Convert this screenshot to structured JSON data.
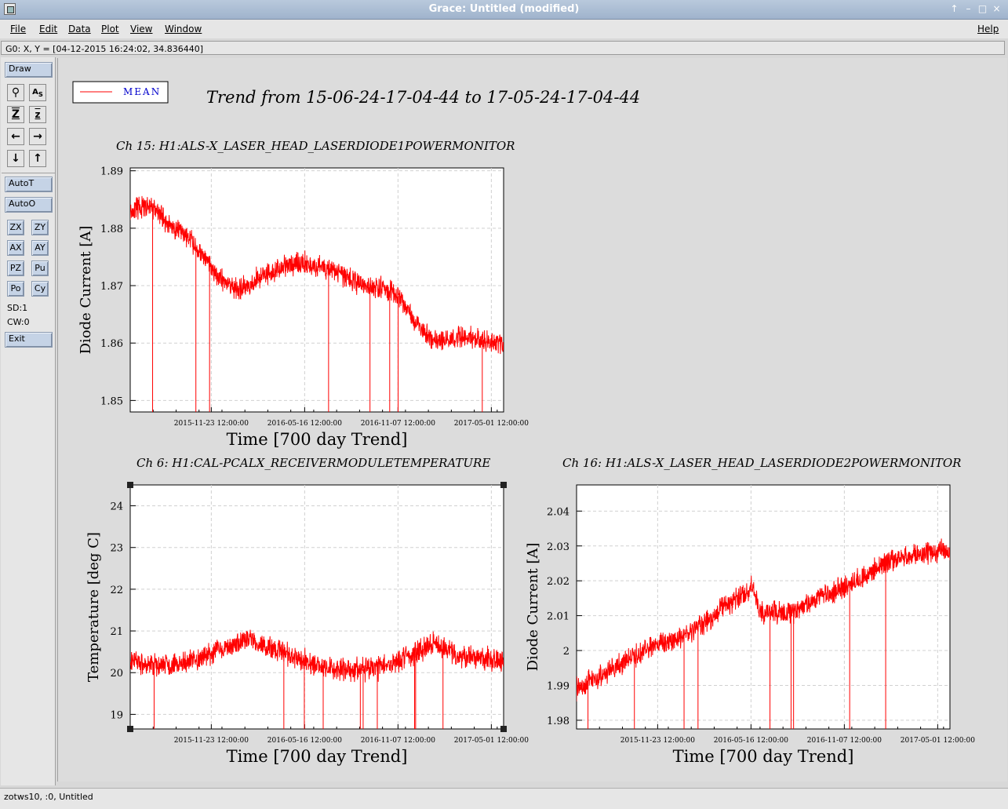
{
  "window": {
    "title": "Grace: Untitled (modified)"
  },
  "menu": {
    "items": [
      "File",
      "Edit",
      "Data",
      "Plot",
      "View",
      "Window"
    ],
    "help": "Help"
  },
  "locator": "G0: X, Y = [04-12-2015 16:24:02, 34.836440]",
  "toolbar": {
    "draw": "Draw",
    "auto_t": "AutoT",
    "auto_o": "AutoO",
    "small_buttons": [
      "ZX",
      "ZY",
      "AX",
      "AY",
      "PZ",
      "Pu",
      "Po",
      "Cy"
    ],
    "sd": "SD:1",
    "cw": "CW:0",
    "exit": "Exit",
    "icons": [
      "zoom-icon",
      "autoscale-icon",
      "zoom-in-icon",
      "zoom-out-icon",
      "left-arrow-icon",
      "right-arrow-icon",
      "down-arrow-icon",
      "up-arrow-icon"
    ]
  },
  "legend": {
    "label": "MEAN",
    "color": "#ff0000"
  },
  "page_title": "Trend from 15-06-24-17-04-44 to 17-05-24-17-04-44",
  "status": "zotws10, :0, Untitled",
  "chart_data": [
    {
      "type": "line",
      "title": "Ch 15: H1:ALS-X_LASER_HEAD_LASERDIODE1POWERMONITOR",
      "xlabel": "Time [700 day Trend]",
      "ylabel": "Diode Current [A]",
      "xlim": [
        "2015-06-24",
        "2017-05-24"
      ],
      "ylim": [
        1.848,
        1.8905
      ],
      "yticks": [
        1.85,
        1.86,
        1.87,
        1.88,
        1.89
      ],
      "ytick_labels": [
        "1.85",
        "1.86",
        "1.87",
        "1.88",
        "1.89"
      ],
      "xtick_labels": [
        "2015-11-23 12:00:00",
        "2016-05-16 12:00:00",
        "2016-11-07 12:00:00",
        "2017-05-01 12:00:00"
      ],
      "grid": true,
      "series": [
        {
          "name": "MEAN",
          "x": [
            "2015-06-24",
            "2015-08-01",
            "2015-09-01",
            "2015-10-15",
            "2015-12-01",
            "2016-01-15",
            "2016-03-01",
            "2016-05-01",
            "2016-07-01",
            "2016-09-01",
            "2016-11-01",
            "2016-12-01",
            "2017-01-15",
            "2017-03-01",
            "2017-05-24"
          ],
          "y": [
            1.883,
            1.884,
            1.881,
            1.878,
            1.872,
            1.869,
            1.872,
            1.874,
            1.873,
            1.87,
            1.869,
            1.865,
            1.86,
            1.861,
            1.86
          ]
        }
      ]
    },
    {
      "type": "line",
      "title": "Ch 6: H1:CAL-PCALX_RECEIVERMODULETEMPERATURE",
      "xlabel": "Time [700 day Trend]",
      "ylabel": "Temperature [deg C]",
      "xlim": [
        "2015-06-24",
        "2017-05-24"
      ],
      "ylim": [
        18.65,
        24.5
      ],
      "yticks": [
        19,
        20,
        21,
        22,
        23,
        24
      ],
      "ytick_labels": [
        "19",
        "20",
        "21",
        "22",
        "23",
        "24"
      ],
      "xtick_labels": [
        "2015-11-23 12:00:00",
        "2016-05-16 12:00:00",
        "2016-11-07 12:00:00",
        "2017-05-01 12:00:00"
      ],
      "grid": true,
      "series": [
        {
          "name": "MEAN",
          "x": [
            "2015-06-24",
            "2015-08-01",
            "2015-10-01",
            "2015-12-01",
            "2016-02-01",
            "2016-04-01",
            "2016-06-01",
            "2016-08-01",
            "2016-10-01",
            "2016-12-01",
            "2017-01-15",
            "2017-03-01",
            "2017-05-24"
          ],
          "y": [
            20.3,
            20.15,
            20.2,
            20.5,
            20.8,
            20.5,
            20.2,
            20.05,
            20.1,
            20.4,
            20.7,
            20.4,
            20.3
          ]
        }
      ]
    },
    {
      "type": "line",
      "title": "Ch 16: H1:ALS-X_LASER_HEAD_LASERDIODE2POWERMONITOR",
      "xlabel": "Time [700 day Trend]",
      "ylabel": "Diode Current [A]",
      "xlim": [
        "2015-06-24",
        "2017-05-24"
      ],
      "ylim": [
        1.9775,
        2.0475
      ],
      "yticks": [
        1.98,
        1.99,
        2.0,
        2.01,
        2.02,
        2.03,
        2.04
      ],
      "ytick_labels": [
        "1.98",
        "1.99",
        "2",
        "2.01",
        "2.02",
        "2.03",
        "2.04"
      ],
      "xtick_labels": [
        "2015-11-23 12:00:00",
        "2016-05-16 12:00:00",
        "2016-11-07 12:00:00",
        "2017-05-01 12:00:00"
      ],
      "grid": true,
      "series": [
        {
          "name": "MEAN",
          "x": [
            "2015-06-24",
            "2015-08-01",
            "2015-10-01",
            "2015-12-01",
            "2016-02-01",
            "2016-04-01",
            "2016-05-20",
            "2016-06-01",
            "2016-08-01",
            "2016-10-01",
            "2016-12-01",
            "2017-02-01",
            "2017-05-24"
          ],
          "y": [
            1.989,
            1.992,
            1.998,
            2.002,
            2.006,
            2.013,
            2.018,
            2.011,
            2.011,
            2.016,
            2.02,
            2.026,
            2.029
          ]
        }
      ]
    }
  ]
}
